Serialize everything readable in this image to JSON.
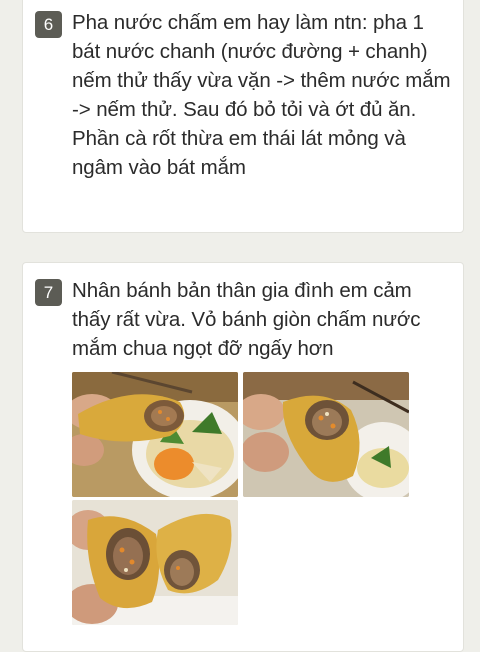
{
  "steps": [
    {
      "number": "6",
      "text": "Pha nước chấm em hay làm ntn: pha 1 bát nước chanh (nước đường + chanh) nếm thử thấy vừa vặn -> thêm nước mắm -> nếm thử. Sau đó bỏ tỏi và ớt đủ ăn. Phần cà rốt thừa em thái lát mỏng và ngâm vào bát mắm"
    },
    {
      "number": "7",
      "text": "Nhân bánh bản thân gia đình em cảm thấy rất vừa. Vỏ bánh giòn chấm nước mắm chua ngọt đỡ ngấy hơn"
    }
  ],
  "colors": {
    "badge_bg": "#5c5c55",
    "page_bg": "#efefea",
    "card_bg": "#ffffff",
    "text": "#2b2b2b"
  }
}
